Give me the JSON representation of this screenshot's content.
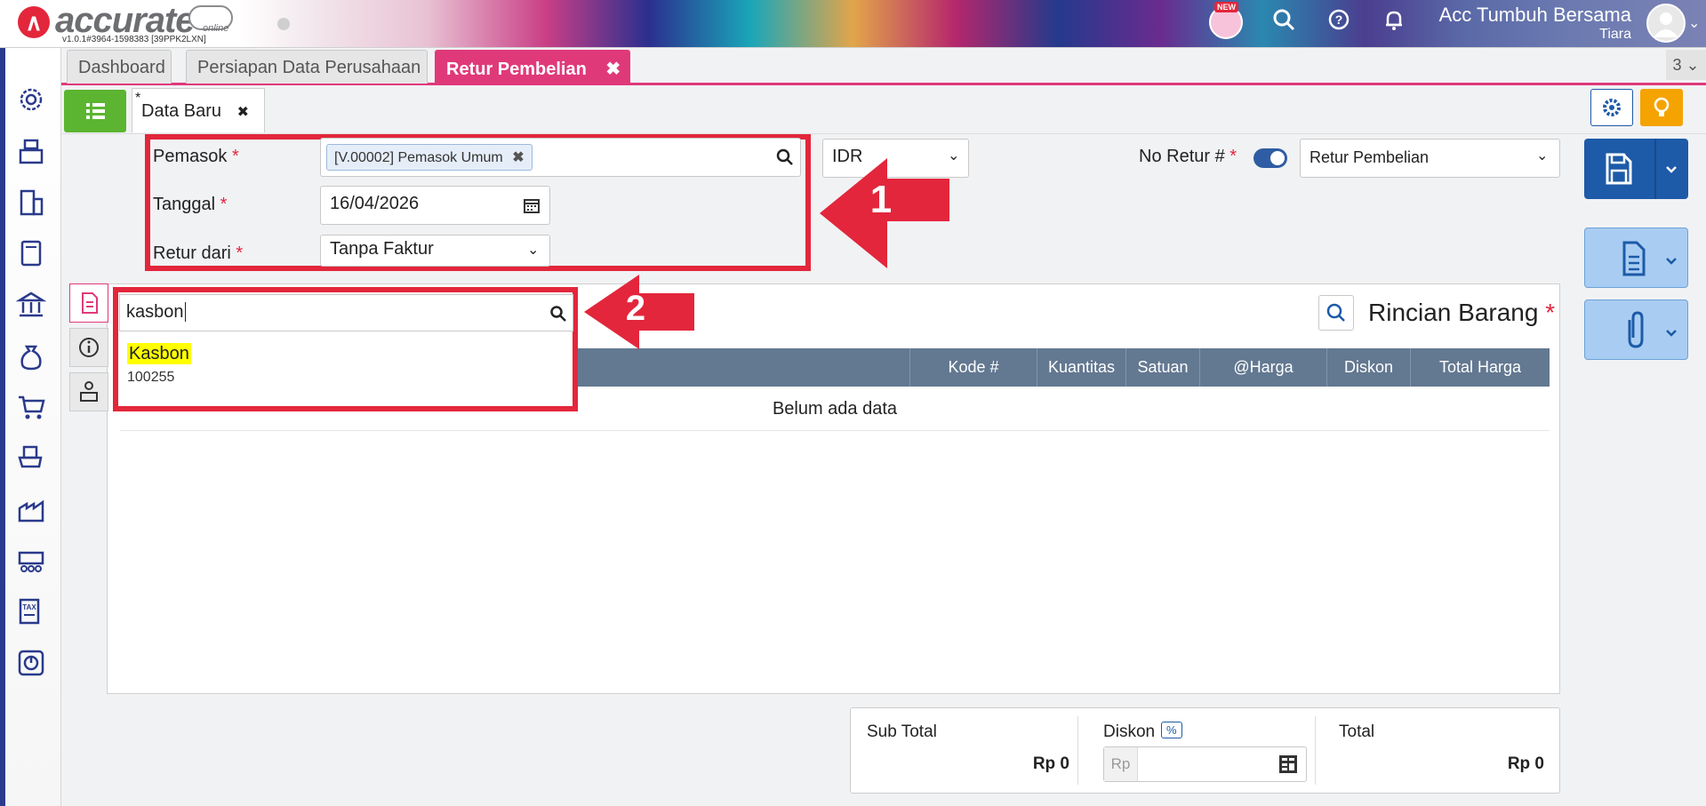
{
  "app": {
    "logo_text": "accurate",
    "logo_sub": "online",
    "version": "v1.0.1#3964-1598383 [39PPK2LXN]",
    "company": "Acc Tumbuh Bersama",
    "user": "Tiara",
    "new_badge": "NEW"
  },
  "tabs": [
    {
      "label": "Dashboard"
    },
    {
      "label": "Persiapan Data Perusahaan"
    },
    {
      "label": "Retur Pembelian",
      "close": "✖"
    }
  ],
  "tab_count": "3 ⌄",
  "subtab": {
    "prefix": "*",
    "label": "Data Baru",
    "close": "✖"
  },
  "form": {
    "pemasok_label": "Pemasok",
    "pemasok_value": "[V.00002] Pemasok Umum",
    "tanggal_label": "Tanggal",
    "tanggal_value": "16/04/2026",
    "retur_label": "Retur dari",
    "retur_value": "Tanpa Faktur",
    "currency": "IDR",
    "no_retur_label": "No Retur #",
    "tipe_value": "Retur Pembelian",
    "required_mark": "*"
  },
  "detail": {
    "title": "Rincian Barang",
    "columns": [
      "Kode #",
      "Kuantitas",
      "Satuan",
      "@Harga",
      "Diskon",
      "Total Harga"
    ],
    "empty_text": "Belum ada data"
  },
  "search": {
    "query": "kasbon",
    "result_name": "Kasbon",
    "result_code": "100255"
  },
  "totals": {
    "subtotal_label": "Sub Total",
    "subtotal_value": "Rp 0",
    "diskon_label": "Diskon",
    "diskon_badge": "%",
    "diskon_placeholder": "Rp",
    "total_label": "Total",
    "total_value": "Rp 0"
  },
  "annotations": {
    "arrow1": "1",
    "arrow2": "2"
  },
  "colors": {
    "accent": "#e0397a",
    "primary": "#1d5aa8",
    "highlight": "#e3263b",
    "green": "#5bb531"
  }
}
